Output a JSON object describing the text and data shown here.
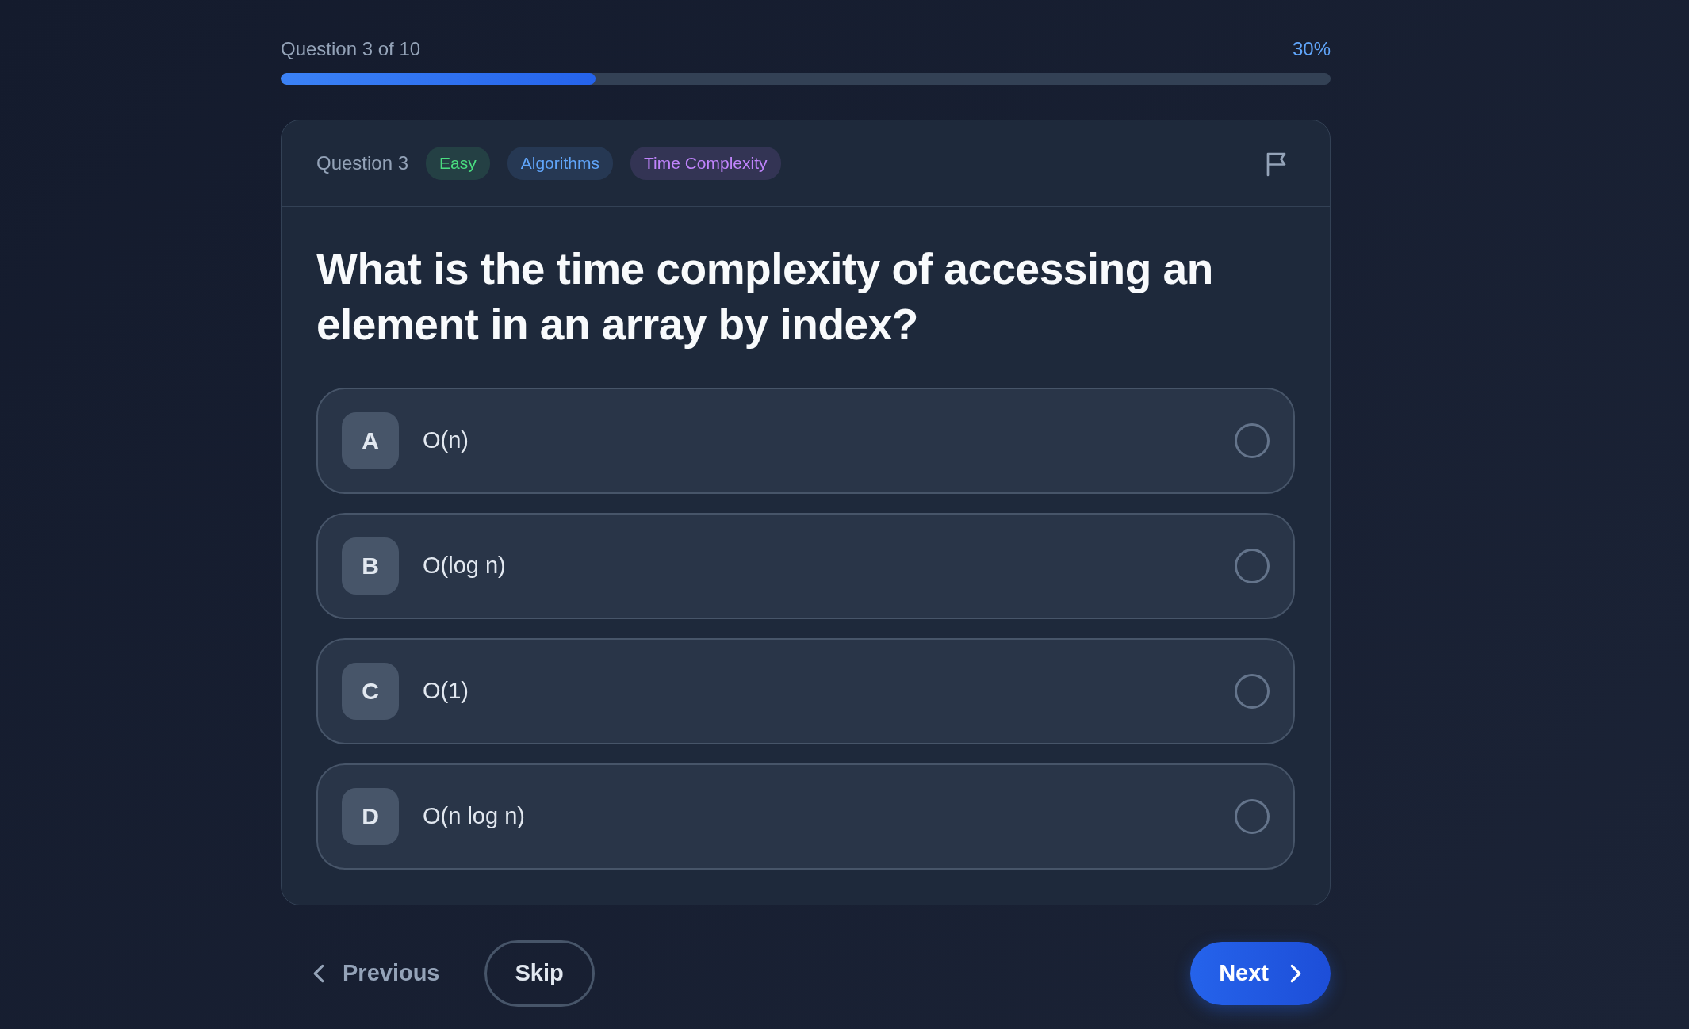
{
  "progress": {
    "label": "Question 3 of 10",
    "percent": "30%",
    "level": 0.3
  },
  "card": {
    "number": "Question 3",
    "tags": [
      {
        "label": "Easy",
        "color": "#4ade80"
      },
      {
        "label": "Algorithms",
        "color": "#60a5fa"
      },
      {
        "label": "Time Complexity",
        "color": "#c084fc"
      }
    ],
    "flagged": false,
    "question": "What is the time complexity of accessing an element in an array by index?",
    "options": [
      {
        "letter": "A",
        "text": "O(n)",
        "selected": false
      },
      {
        "letter": "B",
        "text": "O(log n)",
        "selected": false
      },
      {
        "letter": "C",
        "text": "O(1)",
        "selected": false
      },
      {
        "letter": "D",
        "text": "O(n log n)",
        "selected": false
      }
    ]
  },
  "nav": {
    "previous": "Previous",
    "skip": "Skip",
    "next": "Next"
  }
}
